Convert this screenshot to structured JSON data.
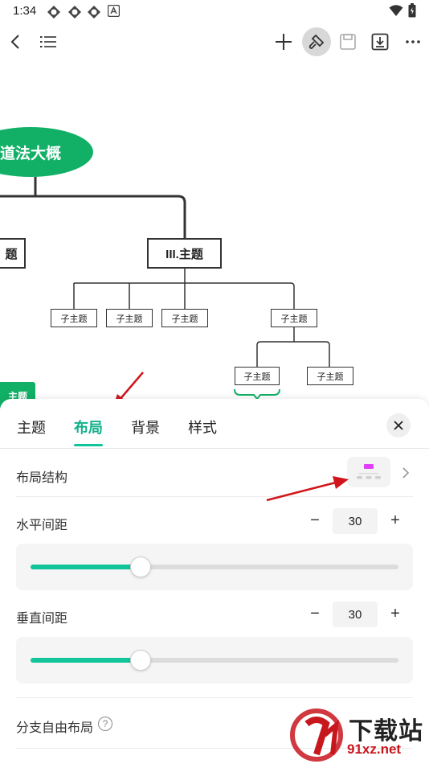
{
  "status_bar": {
    "time": "1:34",
    "icons": [
      "app-icon",
      "app-icon",
      "app-icon",
      "a-icon"
    ],
    "right_icons": [
      "wifi-icon",
      "battery-icon"
    ]
  },
  "toolbar": {
    "left_icons": [
      "back-icon",
      "outline-list-icon"
    ],
    "right_icons": [
      "add-icon",
      "format-brush-icon",
      "save-icon",
      "export-icon",
      "more-icon"
    ]
  },
  "mindmap": {
    "root": "道法大概",
    "main_topics": [
      "题",
      "III.主题"
    ],
    "subtopics": [
      "子主题",
      "子主题",
      "子主题",
      "子主题"
    ],
    "sub_subtopics": [
      "子主题",
      "子主题"
    ],
    "partial_green_node": "主题"
  },
  "panel": {
    "tabs": [
      {
        "label": "主题",
        "active": false
      },
      {
        "label": "布局",
        "active": true
      },
      {
        "label": "背景",
        "active": false
      },
      {
        "label": "样式",
        "active": false
      }
    ],
    "layout_structure_label": "布局结构",
    "horizontal_spacing_label": "水平间距",
    "horizontal_spacing_value": "30",
    "horizontal_spacing_fraction": 0.3,
    "vertical_spacing_label": "垂直间距",
    "vertical_spacing_value": "30",
    "vertical_spacing_fraction": 0.3,
    "minus_symbol": "−",
    "plus_symbol": "+",
    "branch_free_layout_label": "分支自由布局",
    "help_symbol": "?"
  },
  "watermark": {
    "text_cn": "下载站",
    "text_url": "91xz.net"
  },
  "colors": {
    "accent": "#12c49a",
    "root_green": "#12b067",
    "annotation_arrow": "#d0161c"
  }
}
